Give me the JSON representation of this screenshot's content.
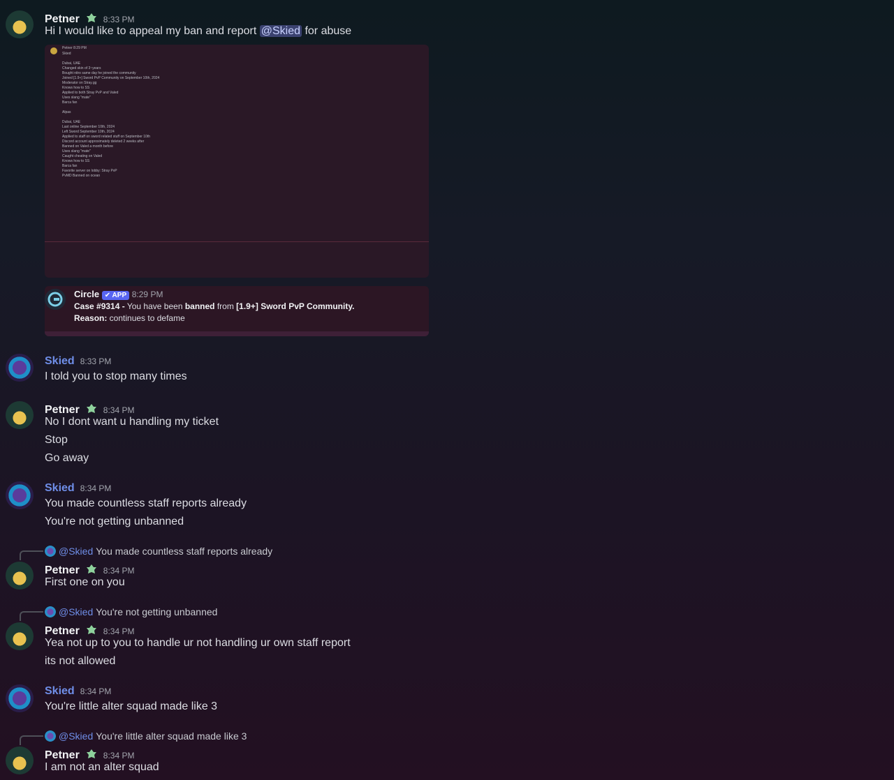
{
  "colors": {
    "accent_mention": "#3b4270",
    "skied_name": "#6f8ee8",
    "app_badge": "#5865f2"
  },
  "messages": {
    "m1": {
      "author": "Petner",
      "time": "8:33 PM",
      "text_before": "Hi I would like to appeal my ban and report ",
      "mention": "@Skied",
      "text_after": " for abuse"
    },
    "m2": {
      "author": "Skied",
      "time": "8:33 PM",
      "lines": [
        "I told you to stop many times"
      ]
    },
    "m3": {
      "author": "Petner",
      "time": "8:34 PM",
      "lines": [
        "No I dont want u handling my ticket",
        "Stop",
        "Go away"
      ]
    },
    "m4": {
      "author": "Skied",
      "time": "8:34 PM",
      "lines": [
        "You made countless staff reports already",
        "You're not getting unbanned"
      ]
    },
    "m5": {
      "reply_name": "@Skied",
      "reply_text": "You made countless staff reports already",
      "author": "Petner",
      "time": "8:34 PM",
      "lines": [
        "First one on you"
      ]
    },
    "m6": {
      "reply_name": "@Skied",
      "reply_text": "You're not getting unbanned",
      "author": "Petner",
      "time": "8:34 PM",
      "lines": [
        "Yea not up to you to handle ur not handling ur own staff report",
        "its not allowed"
      ]
    },
    "m7": {
      "author": "Skied",
      "time": "8:34 PM",
      "lines": [
        "You're little alter squad made like 3"
      ]
    },
    "m8": {
      "reply_name": "@Skied",
      "reply_text": "You're little alter squad made like 3",
      "author": "Petner",
      "time": "8:34 PM",
      "lines": [
        "I am not an alter squad"
      ]
    }
  },
  "attachment_screenshot": {
    "header_name": "Petner",
    "header_time": "8:29 PM",
    "lines": [
      "Skied",
      "",
      "Dubai, UAE",
      "Changed skin of 3~years",
      "Bought nitro same day he joined the community",
      "Joined [1.9+] Sword PvP Community on September 10th, 2024",
      "Moderator on Stray.gg",
      "Knows how to SS",
      "Applied to both Stray PvP and Valed",
      "Uses slang \"mate\"",
      "Barca fan",
      "",
      "Alpas",
      "",
      "Dubai, UAE",
      "Last online September 10th, 2024",
      "Left Sword September 10th, 2024",
      "Applied to staff on sword related stuff on September 10th",
      "Discord account approximately deleted 2 weeks after",
      "Banned on Valed a month before",
      "Uses slang \"mate\"",
      "Caught cheating on Valed",
      "Knows how to SS",
      "Barca fan",
      "Favorite server on lobby: Stray PvP",
      "PvMD Banned on ocean"
    ]
  },
  "embed": {
    "bot_name": "Circle",
    "app_label": "✔ APP",
    "time": "8:29 PM",
    "case": "Case #9314 -",
    "case_text": " You have been ",
    "banned": "banned",
    "from": " from ",
    "community": "[1.9+] Sword PvP Community.",
    "reason_label": "Reason:",
    "reason": " continues to defame"
  }
}
